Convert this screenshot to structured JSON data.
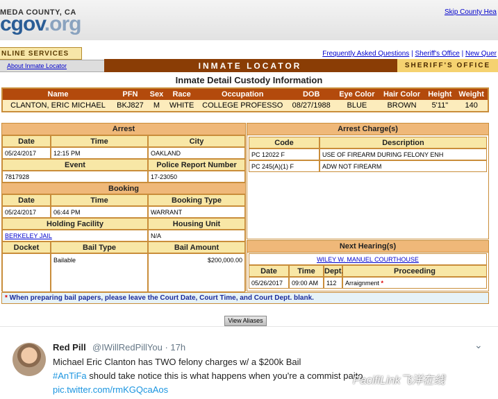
{
  "header": {
    "county": "MEDA COUNTY, CA",
    "logo_main": "cgov",
    "logo_org": ".org",
    "skip_link": "Skip County Hea",
    "online_services": "NLINE SERVICES",
    "links": [
      "Frequently Asked Questions",
      "Sheriff's Office",
      "New Quer"
    ],
    "about_link": "About Inmate Locator",
    "locator_bar": "INMATE LOCATOR",
    "sheriff_bar": "SHERIFF'S OFFICE"
  },
  "page_title": "Inmate Detail Custody Information",
  "identity": {
    "headers": [
      "Name",
      "PFN",
      "Sex",
      "Race",
      "Occupation",
      "DOB",
      "Eye Color",
      "Hair Color",
      "Height",
      "Weight"
    ],
    "values": [
      "CLANTON, ERIC MICHAEL",
      "BKJ827",
      "M",
      "WHITE",
      "COLLEGE PROFESSO",
      "08/27/1988",
      "BLUE",
      "BROWN",
      "5'11\"",
      "140"
    ]
  },
  "arrest": {
    "title": "Arrest",
    "row_headers": [
      "Date",
      "Time",
      "City"
    ],
    "row_values": [
      "05/24/2017",
      "12:15 PM",
      "OAKLAND"
    ],
    "event_header": "Event",
    "report_header": "Police Report Number",
    "event_value": "7817928",
    "report_value": "17-23050"
  },
  "booking": {
    "title": "Booking",
    "headers": [
      "Date",
      "Time",
      "Booking Type"
    ],
    "values": [
      "05/24/2017",
      "06:44 PM",
      "WARRANT"
    ],
    "facility_header": "Holding Facility",
    "unit_header": "Housing Unit",
    "facility_value": "BERKELEY JAIL",
    "unit_value": "N/A"
  },
  "bail": {
    "headers": [
      "Docket",
      "Bail Type",
      "Bail Amount"
    ],
    "docket": "",
    "type": "Bailable",
    "amount": "$200,000.00"
  },
  "charges": {
    "title": "Arrest Charge(s)",
    "headers": [
      "Code",
      "Description"
    ],
    "rows": [
      {
        "code": "PC 12022 F",
        "desc": "USE OF FIREARM DURING FELONY ENH"
      },
      {
        "code": "PC 245(A)(1) F",
        "desc": "ADW NOT FIREARM"
      }
    ]
  },
  "hearing": {
    "title": "Next Hearing(s)",
    "court": "WILEY W. MANUEL COURTHOUSE",
    "headers": [
      "Date",
      "Time",
      "Dept.",
      "Proceeding"
    ],
    "values": [
      "05/26/2017",
      "09:00 AM",
      "112",
      "Arraignment"
    ],
    "star": "*"
  },
  "note": {
    "star": "*",
    "text": " When preparing bail papers, please leave the Court Date, Court Time, and Court Dept. blank."
  },
  "view_aliases": "View Aliases",
  "tweet": {
    "name": "Red Pill",
    "handle": "@IWillRedPillYou · 17h",
    "line1": "Michael Eric Clanton has TWO felony charges w/ a $200k Bail",
    "hashtag": "#AnTiFa",
    "line2": " should take notice this is what happens when you're a comm",
    "line2_end": "ist paito",
    "link": "pic.twitter.com/rmKGQcaAos",
    "chevron": "⌄"
  },
  "watermark": "PacifiLink飞洋在线",
  "colors": {
    "accent": "#b34a0c",
    "panel_header": "#efb879",
    "sub_header": "#f8e7a6",
    "link": "#0000cc",
    "tweet_link": "#1b95e0"
  }
}
